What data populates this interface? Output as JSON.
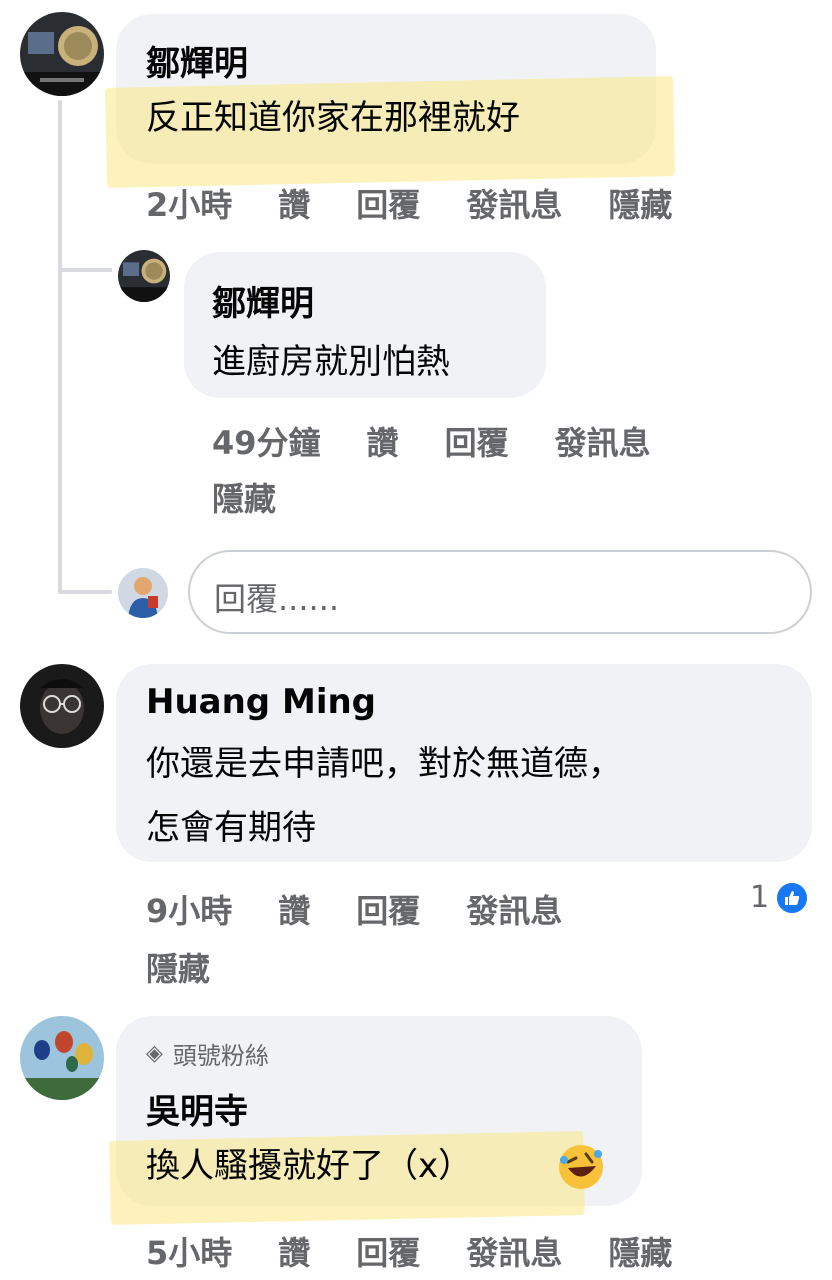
{
  "comments": [
    {
      "author": "鄒輝明",
      "text": "反正知道你家在那裡就好",
      "time": "2小時",
      "actions": [
        "讚",
        "回覆",
        "發訊息",
        "隱藏"
      ],
      "reply": {
        "author": "鄒輝明",
        "text": "進廚房就別怕熱",
        "time": "49分鐘",
        "actions": [
          "讚",
          "回覆",
          "發訊息"
        ],
        "hide": "隱藏"
      },
      "reply_input": {
        "placeholder": "回覆......"
      }
    },
    {
      "author": "Huang Ming",
      "text_line1": "你還是去申請吧，對於無道德，",
      "text_line2": "怎會有期待",
      "time": "9小時",
      "actions": [
        "讚",
        "回覆",
        "發訊息"
      ],
      "hide": "隱藏",
      "reaction_count": "1",
      "reaction_icon": "like-icon"
    },
    {
      "badge": "頭號粉絲",
      "badge_icon": "diamond-icon",
      "author": "吳明寺",
      "text": "換人騷擾就好了（x）",
      "emoji": "rolling-laughing-face",
      "time": "5小時",
      "actions": [
        "讚",
        "回覆",
        "發訊息",
        "隱藏"
      ]
    }
  ],
  "colors": {
    "bubble": "#f0f2f5",
    "action_text": "#65676b",
    "like_blue": "#1877f2",
    "highlight": "#fce884"
  }
}
